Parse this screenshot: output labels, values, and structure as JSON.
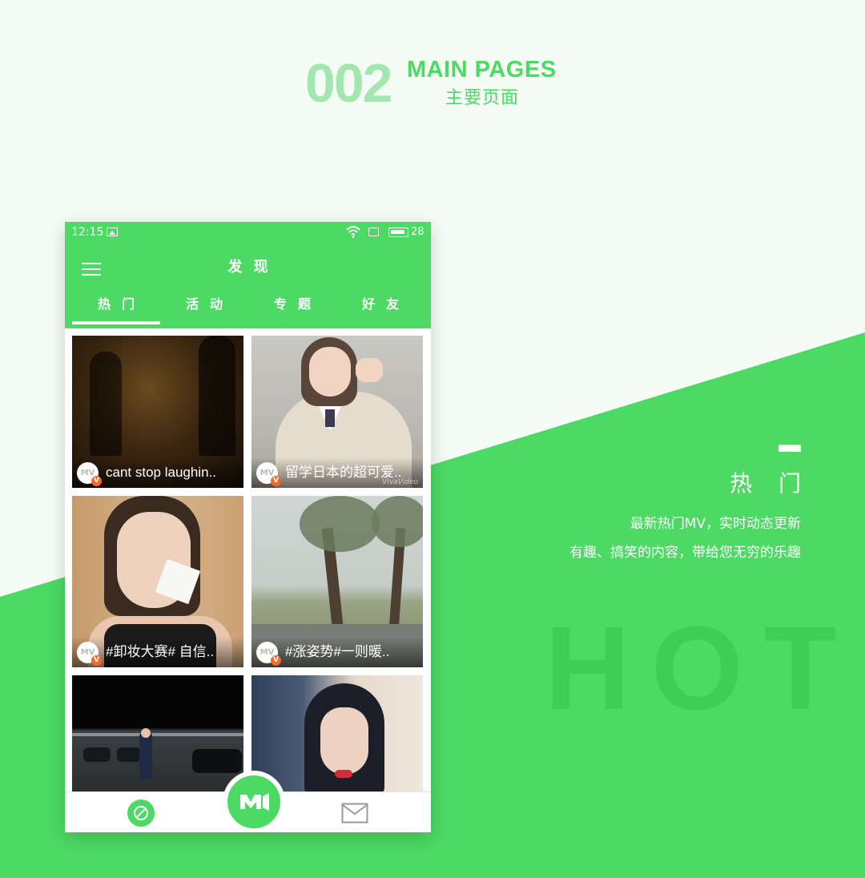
{
  "header": {
    "number": "002",
    "title": "MAIN PAGES",
    "subtitle": "主要页面"
  },
  "side": {
    "title": "热 门",
    "line1": "最新热门MV，实时动态更新",
    "line2": "有趣、搞笑的内容，带给您无穷的乐趣",
    "watermark": "HOT"
  },
  "status_bar": {
    "time": "12:15",
    "battery": "28"
  },
  "app": {
    "title": "发现"
  },
  "tabs": [
    {
      "label": "热门"
    },
    {
      "label": "活动"
    },
    {
      "label": "专题"
    },
    {
      "label": "好友"
    }
  ],
  "cards": [
    {
      "caption": "cant stop laughin..",
      "avatar": "MV",
      "badge": "V"
    },
    {
      "caption": "留学日本的超可爱..",
      "avatar": "MV",
      "badge": "V",
      "watermark": "VivaVideo"
    },
    {
      "caption": "#卸妆大赛# 自信..",
      "avatar": "MV",
      "badge": "V"
    },
    {
      "caption": "#涨姿势#一则暖..",
      "avatar": "MV",
      "badge": "V"
    },
    {
      "caption": "",
      "avatar": "",
      "badge": ""
    },
    {
      "caption": "",
      "avatar": "",
      "badge": ""
    }
  ],
  "bottom_nav": {
    "left_icon": "compass-icon",
    "center_label": "M",
    "right_icon": "mail-icon"
  },
  "colors": {
    "brand_green": "#4cd964",
    "light_green": "#a3e6b0",
    "badge_orange": "#f06c2c"
  }
}
